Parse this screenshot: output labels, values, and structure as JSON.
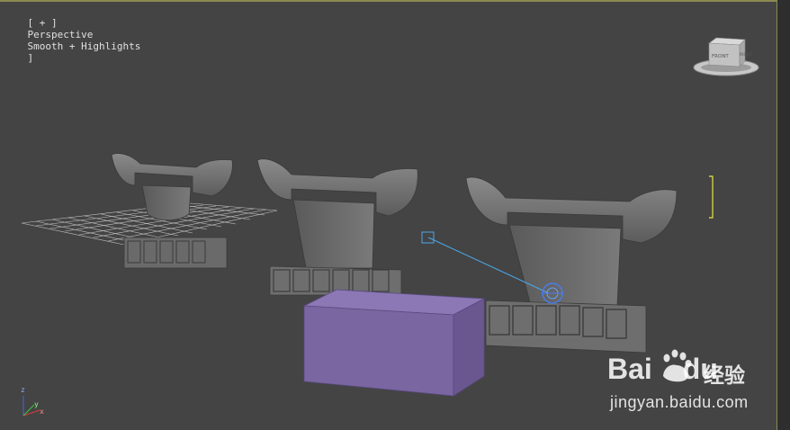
{
  "viewport": {
    "label_bracket_open": "[ + ]",
    "label_view": "Perspective",
    "label_shading": "Smooth + Highlights",
    "label_bracket_close": "]",
    "background_color": "#444444"
  },
  "viewcube": {
    "face_label": "FRONT",
    "side_label": "RIGHT"
  },
  "axis_tripod": {
    "x": "x",
    "y": "y",
    "z": "z"
  },
  "scene": {
    "box_color": "#7a66a0",
    "light_line_color": "#4aa8e8",
    "model_color": "#6e6e6e"
  },
  "watermark": {
    "brand": "Bai",
    "brand_tail": "du",
    "chinese": "经验",
    "url": "jingyan.baidu.com"
  }
}
